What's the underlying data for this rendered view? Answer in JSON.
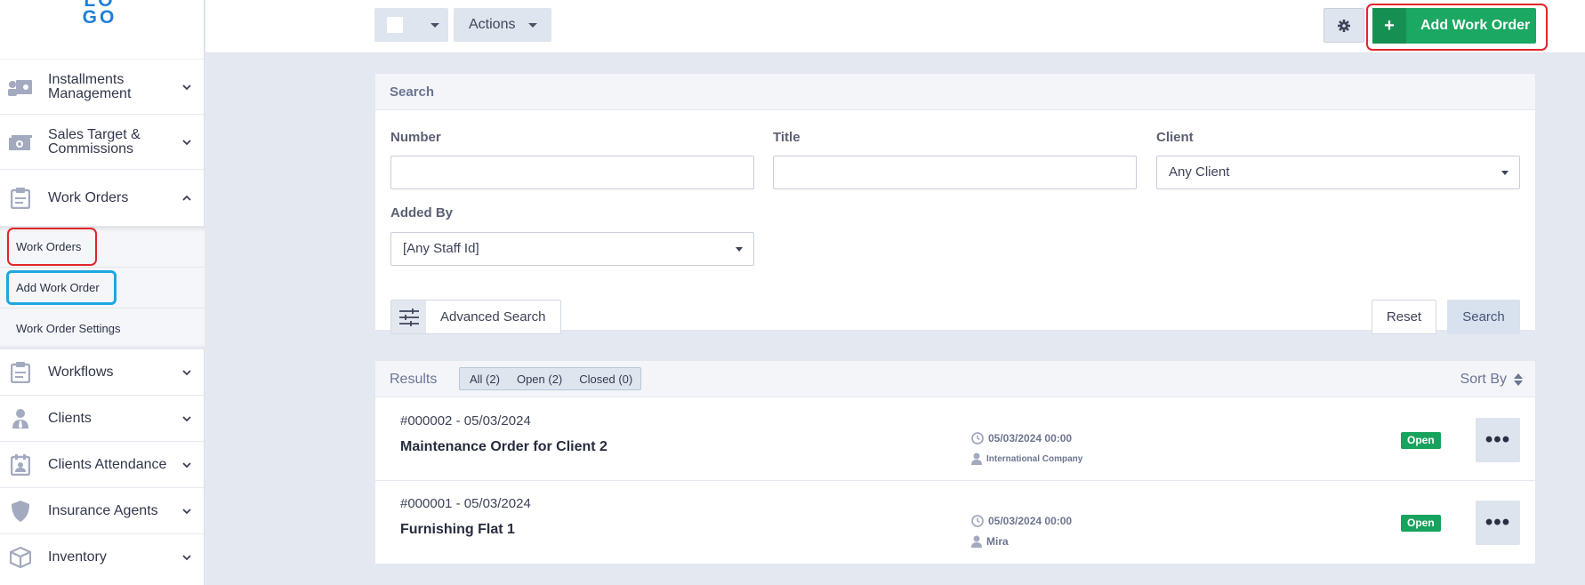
{
  "logo": {
    "text": "LO GO"
  },
  "sidebar": {
    "items": [
      {
        "label_line1": "Installments",
        "label_line2": "Management",
        "icon": "id-card-icon"
      },
      {
        "label_line1": "Sales Target &",
        "label_line2": "Commissions",
        "icon": "money-icon"
      },
      {
        "label": "Work Orders",
        "icon": "clipboard-icon",
        "expanded": true
      },
      {
        "label": "Workflows",
        "icon": "clipboard-icon"
      },
      {
        "label": "Clients",
        "icon": "user-tie-icon"
      },
      {
        "label": "Clients Attendance",
        "icon": "calendar-user-icon"
      },
      {
        "label": "Insurance Agents",
        "icon": "shield-icon"
      },
      {
        "label": "Inventory",
        "icon": "box-icon"
      }
    ],
    "submenu": [
      "Work Orders",
      "Add Work Order",
      "Work Order Settings"
    ]
  },
  "toolbar": {
    "actions_label": "Actions",
    "add_label": "Add Work Order",
    "add_icon": "+"
  },
  "search": {
    "title": "Search",
    "number_label": "Number",
    "title_label": "Title",
    "client_label": "Client",
    "client_value": "Any Client",
    "added_by_label": "Added By",
    "added_by_value": "[Any Staff Id]",
    "advanced_label": "Advanced Search",
    "reset_label": "Reset",
    "search_label": "Search"
  },
  "results": {
    "title": "Results",
    "tabs": [
      "All (2)",
      "Open (2)",
      "Closed (0)"
    ],
    "sort_label": "Sort By",
    "rows": [
      {
        "number": "#000002 - 05/03/2024",
        "title": "Maintenance Order for Client 2",
        "datetime": "05/03/2024 00:00",
        "who": "International Company",
        "status": "Open",
        "more": "•••"
      },
      {
        "number": "#000001 - 05/03/2024",
        "title": "Furnishing Flat 1",
        "datetime": "05/03/2024 00:00",
        "who": "Mira",
        "status": "Open",
        "more": "•••"
      }
    ]
  },
  "colors": {
    "accent_green": "#1aa862",
    "highlight_red": "#e0262b",
    "highlight_blue": "#1ea7df"
  }
}
